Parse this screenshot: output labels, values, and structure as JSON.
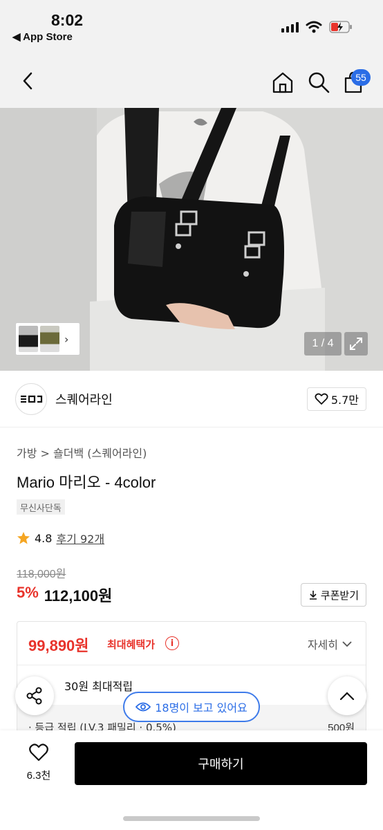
{
  "status_bar": {
    "time": "8:02",
    "back_app": "◀ App Store"
  },
  "header": {
    "cart_count": "55"
  },
  "gallery": {
    "counter": "1 / 4"
  },
  "brand": {
    "name": "스퀘어라인",
    "likes": "5.7만"
  },
  "product": {
    "breadcrumb": "가방 > 숄더백 (스퀘어라인)",
    "title": "Mario 마리오 - 4color",
    "tag": "무신사단독",
    "rating": "4.8",
    "reviews": "후기 92개",
    "original_price": "118,000원",
    "discount": "5%",
    "price": "112,100원",
    "coupon_label": "쿠폰받기"
  },
  "benefit": {
    "best_price": "99,890원",
    "best_label": "최대혜택가",
    "detail_toggle": "자세히",
    "points_title": "30원 최대적립",
    "points_row_label": "· 등급 적립 (LV.3 패밀리 · 0.5%)",
    "points_row_value": "500원"
  },
  "viewers": "18명이 보고 있어요",
  "bottom": {
    "wish_count": "6.3천",
    "buy_label": "구매하기"
  },
  "colors": {
    "accent_red": "#e8332b",
    "accent_blue": "#2b6de6",
    "star": "#f5a623"
  }
}
